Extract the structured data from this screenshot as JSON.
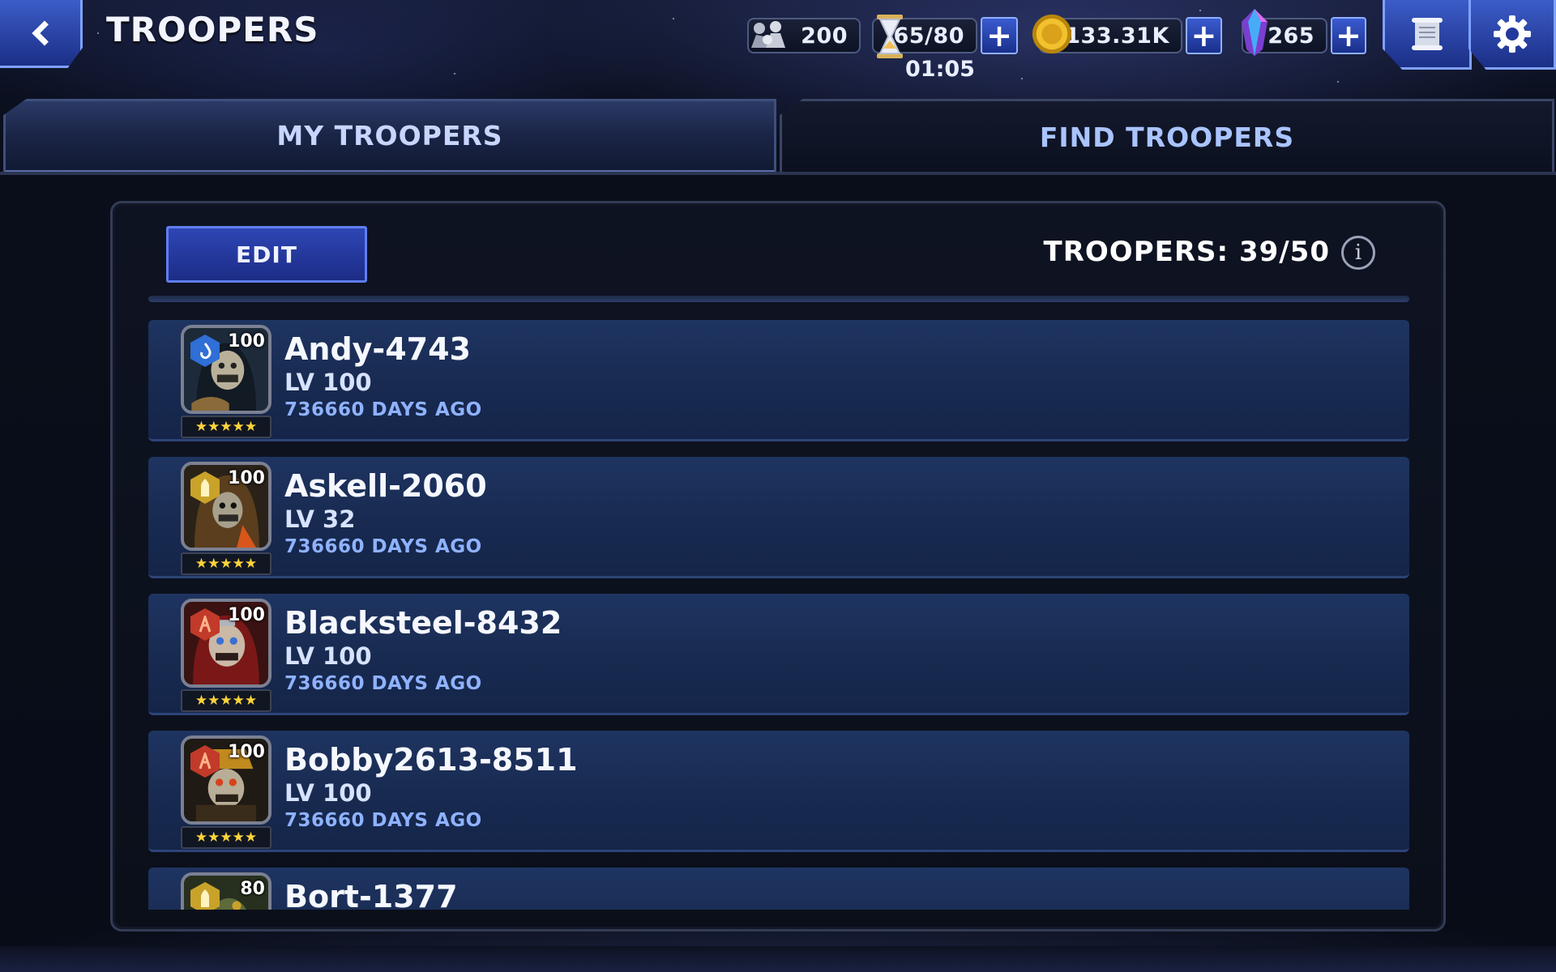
{
  "header": {
    "title": "TROOPERS",
    "back_icon": "back-chevron-icon"
  },
  "resources": {
    "silver": {
      "icon": "silver-soldiers-icon",
      "value": "200"
    },
    "energy": {
      "icon": "hourglass-icon",
      "value": "65/80",
      "timer": "01:05"
    },
    "gold": {
      "icon": "gold-coin-icon",
      "value": "133.31K"
    },
    "gems": {
      "icon": "crystal-gem-icon",
      "value": "265"
    }
  },
  "tabs": {
    "my_troopers": "MY TROOPERS",
    "find_troopers": "FIND TROOPERS",
    "active": "my_troopers"
  },
  "panel": {
    "edit_label": "EDIT",
    "count_label": "TROOPERS: 39/50",
    "info_glyph": "i"
  },
  "troopers": [
    {
      "name": "Andy-4743",
      "level": "LV 100",
      "last_seen": "736660 DAYS AGO",
      "hero_level": "100",
      "class": "water",
      "class_color": "#2f6fd6",
      "stars": "★★★★★"
    },
    {
      "name": "Askell-2060",
      "level": "LV 32",
      "last_seen": "736660 DAYS AGO",
      "hero_level": "100",
      "class": "bullet",
      "class_color": "#c9a22a",
      "stars": "★★★★★"
    },
    {
      "name": "Blacksteel-8432",
      "level": "LV 100",
      "last_seen": "736660 DAYS AGO",
      "hero_level": "100",
      "class": "fire",
      "class_color": "#c23a2a",
      "stars": "★★★★★"
    },
    {
      "name": "Bobby2613-8511",
      "level": "LV 100",
      "last_seen": "736660 DAYS AGO",
      "hero_level": "100",
      "class": "fire",
      "class_color": "#c23a2a",
      "stars": "★★★★★"
    },
    {
      "name": "Bort-1377",
      "level": "",
      "last_seen": "",
      "hero_level": "80",
      "class": "bullet",
      "class_color": "#c9a22a",
      "stars": ""
    }
  ],
  "colors": {
    "accent_blue": "#2e46b5",
    "row_blue": "#1e3461",
    "star_gold": "#ffd43a",
    "sub_text": "#8fb2ff"
  }
}
